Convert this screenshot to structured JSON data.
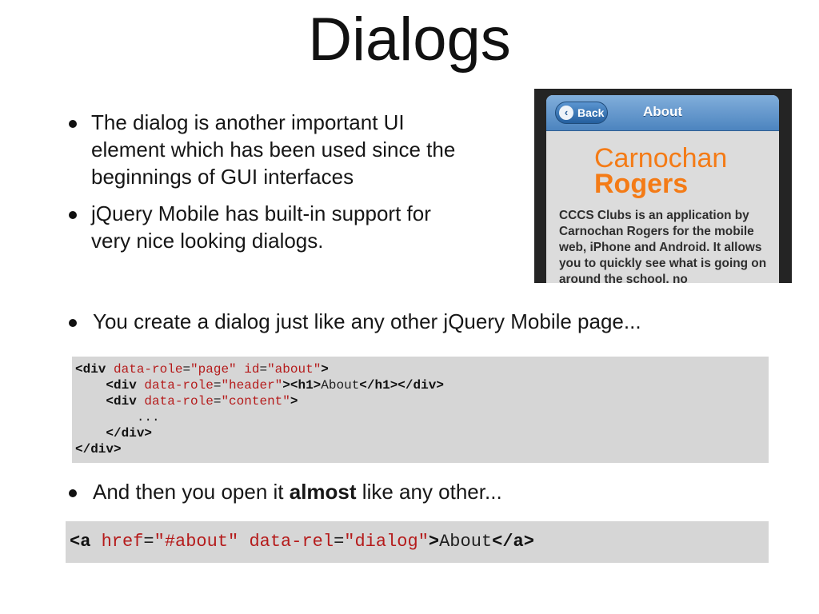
{
  "slide": {
    "title": "Dialogs",
    "bullets": [
      "The dialog is another important UI element which has been used since the beginnings of GUI interfaces",
      "jQuery Mobile has built-in support for very nice looking dialogs."
    ],
    "bullet3": "You create a dialog just like any other jQuery Mobile page...",
    "bullet4": {
      "prefix": "And then you open it ",
      "bold": "almost",
      "suffix": " like any other..."
    }
  },
  "phone": {
    "back_label": "Back",
    "header_title": "About",
    "brand_line1": "Carnochan",
    "brand_line2": "Rogers",
    "about_text": "CCCS Clubs is an application by Carnochan Rogers for the mobile web, iPhone and Android. It allows you to quickly see what is going on around the school, no"
  },
  "code1": {
    "l1": {
      "open": "<div",
      "a1": "data-role",
      "v1": "\"page\"",
      "a2": "id",
      "v2": "\"about\"",
      "close": ">"
    },
    "l2": {
      "open": "<div",
      "a1": "data-role",
      "v1": "\"header\"",
      "mid": "><h1>",
      "text": "About",
      "close": "</h1></div>"
    },
    "l3": {
      "open": "<div",
      "a1": "data-role",
      "v1": "\"content\"",
      "close": ">"
    },
    "l4": "...",
    "l5": "</div>",
    "l6": "</div>"
  },
  "code2": {
    "open": "<a",
    "a1": "href",
    "v1": "\"#about\"",
    "a2": "data-rel",
    "v2": "\"dialog\"",
    "gt": ">",
    "text": "About",
    "close": "</a>"
  }
}
